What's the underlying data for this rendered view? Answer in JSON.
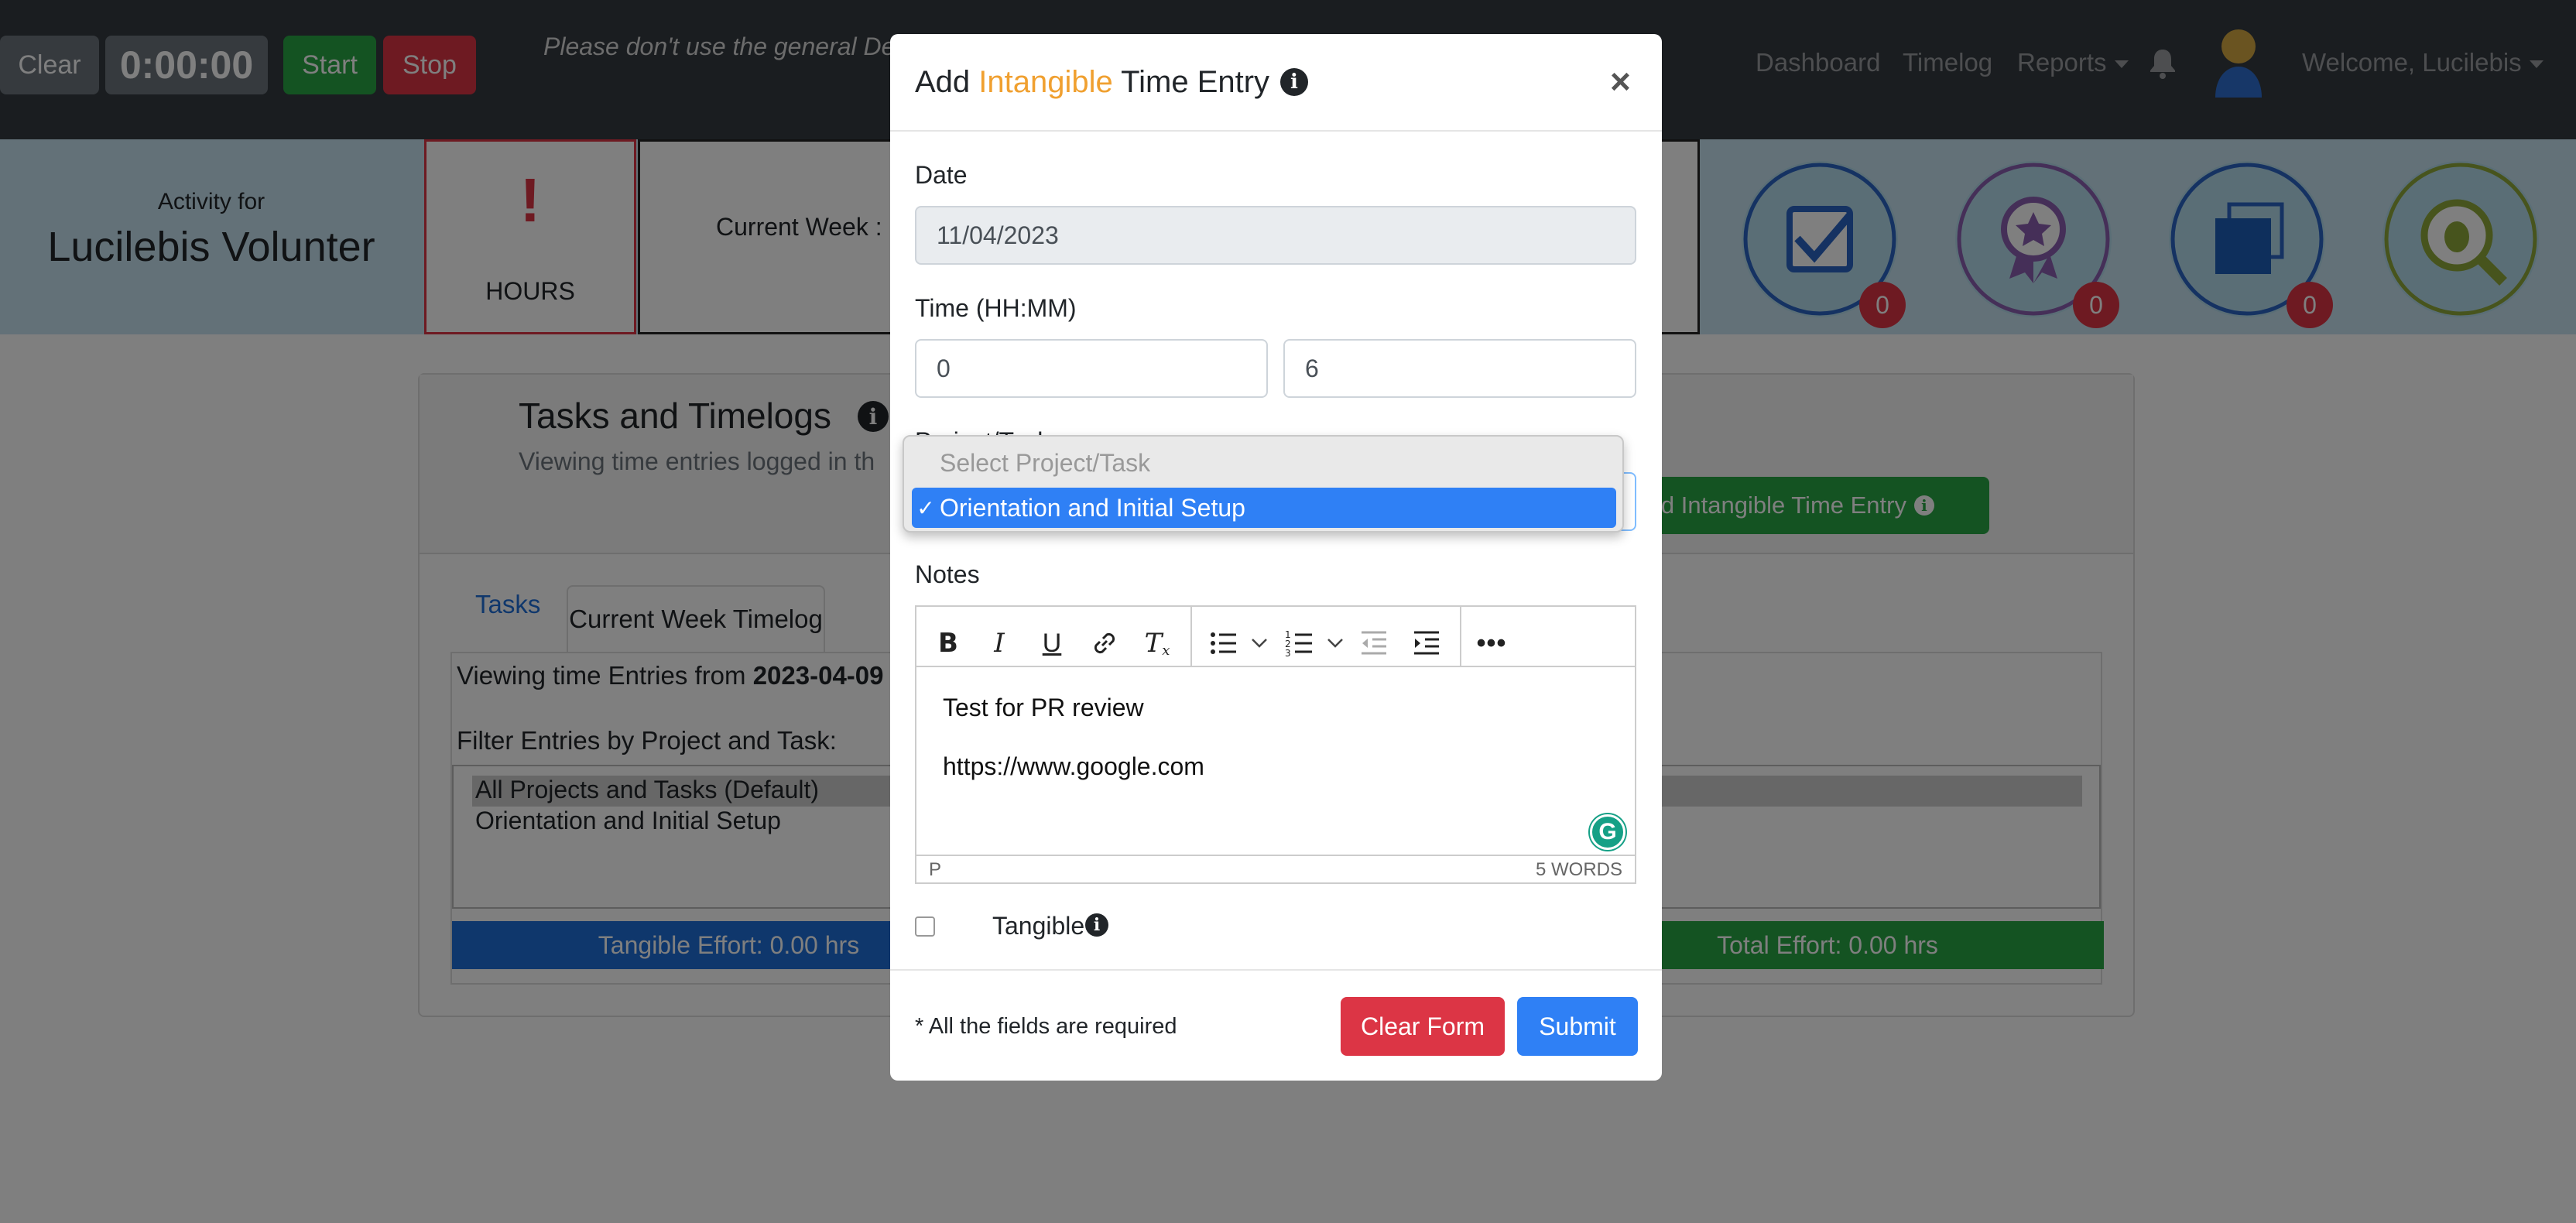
{
  "navbar": {
    "clear_label": "Clear",
    "timer_value": "0:00:00",
    "start_label": "Start",
    "stop_label": "Stop",
    "notice": "Please don't use the general De",
    "links": {
      "dashboard": "Dashboard",
      "timelog": "Timelog",
      "reports": "Reports",
      "welcome": "Welcome, Lucilebis"
    }
  },
  "summary": {
    "activity_for": "Activity for",
    "user_name": "Lucilebis Volunter",
    "hours_icon": "!",
    "hours_label": "HOURS",
    "current_week": "Current Week :",
    "badges": [
      {
        "icon": "tasks-badge-icon",
        "count": "0"
      },
      {
        "icon": "badges-earned-icon",
        "count": "0"
      },
      {
        "icon": "blue-square-record-icon",
        "count": "0"
      },
      {
        "icon": "report-app-bug-icon"
      }
    ]
  },
  "tasks_panel": {
    "title": "Tasks and Timelogs",
    "subtitle": "Viewing time entries logged in th",
    "add_button": "Add Intangible Time Entry",
    "tabs": [
      "Tasks",
      "Current Week Timelog"
    ],
    "viewing_prefix": "Viewing time Entries from ",
    "viewing_date": "2023-04-09",
    "filter_label": "Filter Entries by Project and Task:",
    "filter_options": [
      "All Projects and Tasks (Default)",
      "Orientation and Initial Setup"
    ],
    "tangible_effort": "Tangible Effort: 0.00 hrs",
    "total_effort": "Total Effort: 0.00 hrs"
  },
  "modal": {
    "title_prefix": "Add ",
    "title_highlight": "Intangible",
    "title_suffix": " Time Entry",
    "date_label": "Date",
    "date_value": "11/04/2023",
    "time_label": "Time (HH:MM)",
    "hours_value": "0",
    "minutes_value": "6",
    "project_label": "Project/Task",
    "project_options": [
      "Select Project/Task",
      "Orientation and Initial Setup"
    ],
    "selected_check": "✓",
    "notes_label": "Notes",
    "notes_lines": [
      "Test for PR review",
      "https://www.google.com"
    ],
    "status_path": "P",
    "word_count": "5 WORDS",
    "tangible_label": "Tangible",
    "required_note": "* All the fields are required",
    "clear_form": "Clear Form",
    "submit": "Submit"
  },
  "colors": {
    "accent_orange": "#f0a030",
    "success": "#28a745",
    "danger": "#dc3545",
    "primary": "#2f80f5"
  }
}
